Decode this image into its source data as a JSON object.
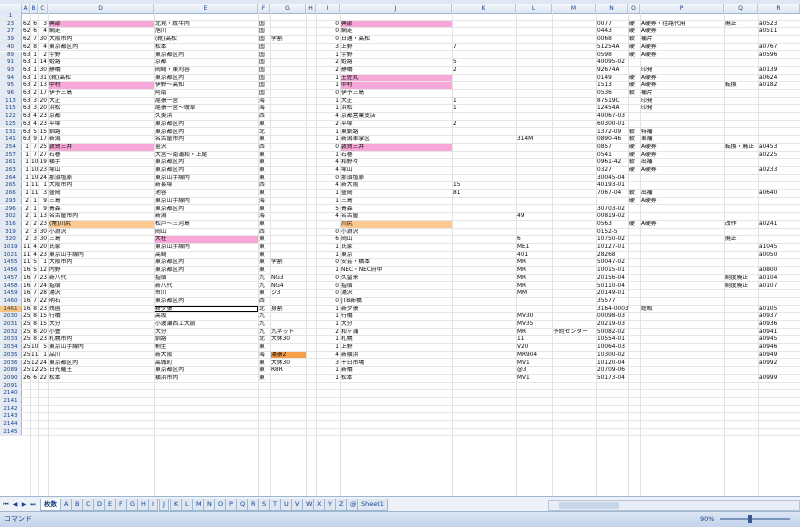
{
  "columns": [
    "A",
    "B",
    "C",
    "D",
    "E",
    "F",
    "G",
    "H",
    "I",
    "J",
    "K",
    "L",
    "M",
    "N",
    "O",
    "P",
    "Q",
    "R"
  ],
  "status": {
    "mode": "コマンド",
    "zoom": "90%"
  },
  "tabs": [
    "枚数",
    "A",
    "B",
    "C",
    "D",
    "E",
    "F",
    "G",
    "H",
    "I",
    "J",
    "K",
    "L",
    "M",
    "N",
    "O",
    "P",
    "Q",
    "R",
    "S",
    "T",
    "U",
    "V",
    "W",
    "X",
    "Y",
    "Z",
    "@",
    "Sheet1"
  ],
  "active_tab": "枚数",
  "rows": [
    {
      "h": "1",
      "c": [
        "",
        "",
        "",
        "",
        "",
        "",
        "",
        "",
        "",
        "",
        "",
        "",
        "",
        "",
        "",
        "",
        "",
        ""
      ]
    },
    {
      "h": "23",
      "c": [
        "62",
        "6",
        "3",
        "興部",
        "北見・紋牛内",
        "国",
        "",
        "",
        "0",
        "興部",
        "",
        "",
        "",
        "0077",
        "硬",
        "A硬券・往路代用",
        "廃止",
        "a0523"
      ],
      "hl": {
        "D": "pink",
        "J": "pink"
      }
    },
    {
      "h": "27",
      "c": [
        "62",
        "6",
        "4",
        "網走",
        "旭川",
        "国",
        "",
        "",
        "0",
        "網走",
        "",
        "",
        "",
        "0443",
        "硬",
        "A硬券",
        "",
        "a0511"
      ]
    },
    {
      "h": "39",
      "c": [
        "62",
        "7",
        "30",
        "大阪市内",
        "(靴)高松",
        "国",
        "学割",
        "",
        "0",
        "日通・高松",
        "",
        "",
        "",
        "0068",
        "軟",
        "補片",
        "",
        ""
      ]
    },
    {
      "h": "40",
      "c": [
        "62",
        "8",
        "4",
        "東京都区内",
        "松本",
        "国",
        "",
        "",
        "3",
        "上野",
        "7",
        "",
        "",
        "51254A",
        "硬",
        "A硬券",
        "",
        "a0767"
      ]
    },
    {
      "h": "89",
      "c": [
        "63",
        "1",
        "2",
        "宇野",
        "東京都区内",
        "国",
        "",
        "",
        "1",
        "宇野",
        "",
        "",
        "",
        "0598",
        "硬",
        "A硬券",
        "",
        "a0596"
      ]
    },
    {
      "h": "91",
      "c": [
        "63",
        "1",
        "14",
        "姫路",
        "京都",
        "国",
        "",
        "",
        "2",
        "姫路",
        "5",
        "",
        "",
        "40095-02",
        "",
        "",
        "",
        ""
      ]
    },
    {
      "h": "93",
      "c": [
        "63",
        "1",
        "30",
        "静橋",
        "岡崎・東刈谷",
        "国",
        "",
        "",
        "2",
        "静橋",
        "2",
        "",
        "",
        "92674A",
        "",
        "印発",
        "",
        "a0139"
      ]
    },
    {
      "h": "94",
      "c": [
        "63",
        "1",
        "31",
        "(靴)高松",
        "東京都区内",
        "国",
        "",
        "",
        "1",
        "土佐丸",
        "",
        "",
        "",
        "0149",
        "硬",
        "A硬券",
        "",
        "a0624"
      ],
      "hl": {
        "J": "pink"
      }
    },
    {
      "h": "95",
      "c": [
        "63",
        "2",
        "13",
        "中村",
        "伊野〜高知",
        "国",
        "",
        "",
        "1",
        "中村",
        "",
        "",
        "",
        "1513",
        "硬",
        "A硬券",
        "転換",
        "a0182"
      ],
      "hl": {
        "D": "pink",
        "J": "pink"
      }
    },
    {
      "h": "96",
      "c": [
        "63",
        "2",
        "17",
        "伊予三島",
        "阿南",
        "国",
        "",
        "",
        "0",
        "伊予三島",
        "",
        "",
        "",
        "0536",
        "軟",
        "補片",
        "",
        ""
      ]
    },
    {
      "h": "113",
      "c": [
        "63",
        "3",
        "20",
        "大正",
        "尾張一宮",
        "海",
        "",
        "",
        "1",
        "大正",
        "1",
        "",
        "",
        "87519C",
        "",
        "印発",
        "",
        ""
      ]
    },
    {
      "h": "115",
      "c": [
        "63",
        "3",
        "20",
        "浜松",
        "尾張一宮〜岐阜",
        "海",
        "",
        "",
        "1",
        "浜松",
        "1",
        "",
        "",
        "12454A",
        "",
        "印発",
        "",
        ""
      ]
    },
    {
      "h": "122",
      "c": [
        "63",
        "4",
        "23",
        "京都",
        "久美浜",
        "西",
        "",
        "",
        "4",
        "京都営業支店",
        "",
        "",
        "",
        "40067-03",
        "",
        "",
        "",
        ""
      ]
    },
    {
      "h": "125",
      "c": [
        "63",
        "4",
        "23",
        "平塚",
        "東京都区内",
        "東",
        "",
        "",
        "2",
        "平塚",
        "2",
        "",
        "",
        "60300-01",
        "",
        "",
        "",
        ""
      ]
    },
    {
      "h": "131",
      "c": [
        "63",
        "5",
        "15",
        "釧路",
        "東京都区内",
        "北",
        "",
        "",
        "1",
        "東釧路",
        "",
        "",
        "",
        "1372-09",
        "軟",
        "特補",
        "",
        ""
      ]
    },
    {
      "h": "141",
      "c": [
        "63",
        "9",
        "17",
        "新潟",
        "名古屋市内",
        "東",
        "",
        "",
        "1",
        "新潟車掌区",
        "",
        "314M",
        "",
        "0890-46",
        "軟",
        "車補",
        "",
        ""
      ]
    },
    {
      "h": "254",
      "c": [
        "1",
        "7",
        "25",
        "敦賀三井",
        "金沢",
        "西",
        "",
        "",
        "0",
        "敦賀三井",
        "",
        "",
        "",
        "0857",
        "硬",
        "A硬券",
        "転換・廃止",
        "a0453"
      ],
      "hl": {
        "D": "pink",
        "J": "pink"
      }
    },
    {
      "h": "257",
      "c": [
        "1",
        "7",
        "27",
        "石巻",
        "大宮〜南浦和・上尾",
        "東",
        "",
        "",
        "1",
        "石巻",
        "",
        "",
        "",
        "0541",
        "硬",
        "A硬券",
        "",
        "a0225"
      ]
    },
    {
      "h": "261",
      "c": [
        "1",
        "10",
        "19",
        "横手",
        "東京都区内",
        "東",
        "",
        "",
        "4",
        "和野々",
        "",
        "",
        "",
        "0961-42",
        "軟",
        "出補",
        "",
        ""
      ]
    },
    {
      "h": "263",
      "c": [
        "1",
        "10",
        "23",
        "塚山",
        "東京都区内",
        "東",
        "",
        "",
        "4",
        "塚山",
        "",
        "",
        "",
        "0327",
        "硬",
        "A硬券",
        "",
        "a0233"
      ]
    },
    {
      "h": "264",
      "c": [
        "1",
        "10",
        "24",
        "那須塩原",
        "東京山手線内",
        "東",
        "",
        "",
        "0",
        "那須塩原",
        "",
        "",
        "",
        "30045-04",
        "",
        "",
        "",
        ""
      ]
    },
    {
      "h": "265",
      "c": [
        "1",
        "11",
        "1",
        "大阪市内",
        "新長塚",
        "西",
        "",
        "",
        "4",
        "新大阪",
        "15",
        "",
        "",
        "40193-01",
        "",
        "",
        "",
        ""
      ]
    },
    {
      "h": "266",
      "c": [
        "1",
        "11",
        "3",
        "盛岡",
        "池谷",
        "東",
        "",
        "",
        "1",
        "盛岡",
        "81",
        "",
        "",
        "7067-04",
        "軟",
        "出補",
        "",
        "a0640"
      ]
    },
    {
      "h": "293",
      "c": [
        "2",
        "1",
        "9",
        "三島",
        "東京山手線内",
        "海",
        "",
        "",
        "1",
        "三島",
        "",
        "",
        "",
        "",
        "硬",
        "A硬券",
        "",
        ""
      ]
    },
    {
      "h": "296",
      "c": [
        "2",
        "1",
        "9",
        "青森",
        "東京都区内",
        "東",
        "",
        "",
        "5",
        "青森",
        "",
        "",
        "",
        "30703-02",
        "",
        "",
        "",
        ""
      ]
    },
    {
      "h": "302",
      "c": [
        "2",
        "1",
        "13",
        "名古屋市内",
        "新潟",
        "海",
        "",
        "",
        "4",
        "名古屋",
        "",
        "49",
        "",
        "00819-02",
        "",
        "",
        "",
        ""
      ]
    },
    {
      "h": "316",
      "c": [
        "2",
        "2",
        "23",
        "(常)川尻",
        "松戸〜三河島",
        "東",
        "",
        "",
        "",
        "川尻",
        "",
        "",
        "",
        "0563",
        "硬",
        "A硬券",
        "改作",
        "a0241"
      ],
      "hl": {
        "D": "orange",
        "J": "orange"
      }
    },
    {
      "h": "319",
      "c": [
        "2",
        "3",
        "30",
        "小淵沢",
        "岡山",
        "西",
        "",
        "",
        "0",
        "小淵沢",
        "",
        "",
        "",
        "0152-5",
        "",
        "",
        "",
        ""
      ]
    },
    {
      "h": "320",
      "c": [
        "2",
        "3",
        "30",
        "三島",
        "大社",
        "東",
        "",
        "",
        "6",
        "岡山",
        "",
        "6",
        "",
        "10750-02",
        "",
        "",
        "廃止",
        ""
      ],
      "hl": {
        "E": "pink"
      }
    },
    {
      "h": "1019",
      "c": [
        "11",
        "4",
        "20",
        "氏家",
        "東京山手線内",
        "東",
        "",
        "",
        "1",
        "氏家",
        "",
        "ME1",
        "",
        "10127-01",
        "",
        "",
        "",
        "a1045"
      ]
    },
    {
      "h": "1021",
      "c": [
        "11",
        "4",
        "23",
        "東京山手線内",
        "高崎",
        "東",
        "",
        "",
        "1",
        "東京",
        "",
        "401",
        "",
        "28268",
        "",
        "",
        "",
        "a0050"
      ]
    },
    {
      "h": "1455",
      "c": [
        "11",
        "5",
        "1",
        "大阪市内",
        "東京都区内",
        "東",
        "学割",
        "",
        "0",
        "安芸・橋本",
        "",
        "MR",
        "",
        "50047-02",
        "",
        "",
        "",
        ""
      ]
    },
    {
      "h": "1456",
      "c": [
        "16",
        "5",
        "12",
        "内野",
        "東京都区内",
        "東",
        "",
        "",
        "1",
        "NEC・NEC府中",
        "",
        "MR",
        "",
        "10015-01",
        "",
        "",
        "",
        "a0800"
      ]
    },
    {
      "h": "1457",
      "c": [
        "16",
        "7",
        "23",
        "新八代",
        "指宿",
        "九",
        "NG3",
        "",
        "0",
        "久留米",
        "",
        "MR",
        "",
        "20156-04",
        "",
        "",
        "制度廃止",
        "a0104"
      ]
    },
    {
      "h": "1458",
      "c": [
        "16",
        "7",
        "24",
        "指宿",
        "新八代",
        "九",
        "NG4",
        "",
        "0",
        "指宿",
        "",
        "MR",
        "",
        "50110-04",
        "",
        "",
        "制度廃止",
        "a0107"
      ]
    },
    {
      "h": "1459",
      "c": [
        "16",
        "7",
        "28",
        "湯沢",
        "市川",
        "東",
        "ジ3",
        "",
        "0",
        "湯沢",
        "",
        "MM",
        "",
        "20149-01",
        "",
        "",
        "",
        ""
      ]
    },
    {
      "h": "1460",
      "c": [
        "16",
        "7",
        "22",
        "明石",
        "東京都区内",
        "西",
        "",
        "",
        "0",
        "JTB新橋",
        "",
        "",
        "",
        "35577",
        "",
        "",
        "",
        ""
      ]
    },
    {
      "h": "1461",
      "c": [
        "16",
        "8",
        "23",
        "残函",
        "新夕張",
        "北",
        "身割",
        "",
        "1",
        "新夕張",
        "",
        "",
        "",
        "3164-0003-02",
        "",
        "総販",
        "",
        "a0105"
      ],
      "sel": true,
      "selcol": "E"
    },
    {
      "h": "2030",
      "c": [
        "25",
        "8",
        "15",
        "行橋",
        "高坂",
        "九",
        "",
        "",
        "1",
        "行橋",
        "",
        "MV30",
        "",
        "00098-03",
        "",
        "",
        "",
        "a0937"
      ]
    },
    {
      "h": "2031",
      "c": [
        "25",
        "8",
        "15",
        "大分",
        "小波瀬西工大前",
        "九",
        "",
        "",
        "1",
        "大分",
        "",
        "MV35",
        "",
        "20219-03",
        "",
        "",
        "",
        "a0936"
      ]
    },
    {
      "h": "2032",
      "c": [
        "25",
        "8",
        "20",
        "小豊",
        "大分",
        "九",
        "九ネット",
        "",
        "2",
        "和ヶ浦",
        "",
        "MR",
        "予約センター",
        "50082-02",
        "",
        "",
        "",
        "a0941"
      ]
    },
    {
      "h": "2033",
      "c": [
        "25",
        "8",
        "23",
        "札幌市内",
        "釧路",
        "北",
        "大休30",
        "",
        "1",
        "札幌",
        "",
        "11",
        "",
        "10554-01",
        "",
        "",
        "",
        "a0945"
      ]
    },
    {
      "h": "2034",
      "c": [
        "25",
        "10",
        "5",
        "東京山手線内",
        "桐生",
        "東",
        "",
        "",
        "1",
        "上野",
        "",
        "V20",
        "",
        "10064-03",
        "",
        "",
        "",
        "a0946"
      ]
    },
    {
      "h": "2035",
      "c": [
        "25",
        "11",
        "1",
        "品川",
        "新大阪",
        "海",
        "湯張2",
        "",
        "4",
        "新横浜",
        "",
        "MR904",
        "",
        "10300-02",
        "",
        "",
        "",
        "a0949"
      ],
      "hl": {
        "G": "orange2"
      }
    },
    {
      "h": "2036",
      "c": [
        "25",
        "12",
        "24",
        "東京都区内",
        "高城町",
        "東",
        "大休30",
        "",
        "3",
        "十日市場",
        "",
        "MV1",
        "",
        "10120-04",
        "",
        "",
        "",
        "a0992"
      ]
    },
    {
      "h": "2089",
      "c": [
        "25",
        "12",
        "25",
        "日光羅王",
        "東京都区内",
        "東",
        "R8R",
        "",
        "1",
        "新橋",
        "",
        "@3",
        "",
        "20709-06",
        "",
        "",
        "",
        ""
      ]
    },
    {
      "h": "2090",
      "c": [
        "26",
        "6",
        "22",
        "松本",
        "横浜市内",
        "東",
        "",
        "",
        "1",
        "松本",
        "",
        "MV1",
        "",
        "50173-04",
        "",
        "",
        "",
        "a0999"
      ]
    },
    {
      "h": "2091",
      "c": [
        "",
        "",
        "",
        "",
        "",
        "",
        "",
        "",
        "",
        "",
        "",
        "",
        "",
        "",
        "",
        "",
        "",
        ""
      ]
    },
    {
      "h": "2140",
      "c": [
        "",
        "",
        "",
        "",
        "",
        "",
        "",
        "",
        "",
        "",
        "",
        "",
        "",
        "",
        "",
        "",
        "",
        ""
      ]
    },
    {
      "h": "2141",
      "c": [
        "",
        "",
        "",
        "",
        "",
        "",
        "",
        "",
        "",
        "",
        "",
        "",
        "",
        "",
        "",
        "",
        "",
        ""
      ]
    },
    {
      "h": "2142",
      "c": [
        "",
        "",
        "",
        "",
        "",
        "",
        "",
        "",
        "",
        "",
        "",
        "",
        "",
        "",
        "",
        "",
        "",
        ""
      ]
    },
    {
      "h": "2143",
      "c": [
        "",
        "",
        "",
        "",
        "",
        "",
        "",
        "",
        "",
        "",
        "",
        "",
        "",
        "",
        "",
        "",
        "",
        ""
      ]
    },
    {
      "h": "2144",
      "c": [
        "",
        "",
        "",
        "",
        "",
        "",
        "",
        "",
        "",
        "",
        "",
        "",
        "",
        "",
        "",
        "",
        "",
        ""
      ]
    },
    {
      "h": "2145",
      "c": [
        "",
        "",
        "",
        "",
        "",
        "",
        "",
        "",
        "",
        "",
        "",
        "",
        "",
        "",
        "",
        "",
        "",
        ""
      ]
    }
  ]
}
